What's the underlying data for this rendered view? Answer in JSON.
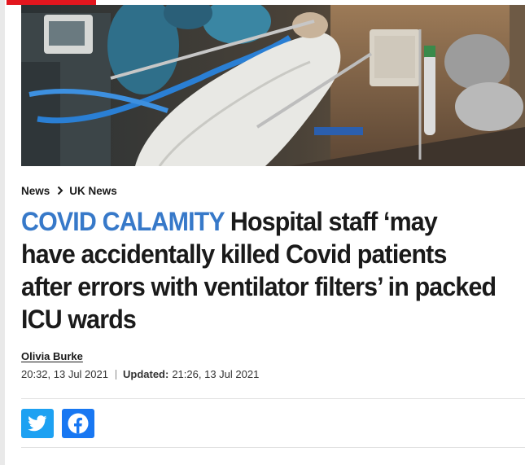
{
  "colors": {
    "kicker": "#3779c9",
    "brand_red": "#e3161e",
    "twitter": "#1da1f2",
    "facebook": "#1877f2"
  },
  "breadcrumb": {
    "items": [
      "News",
      "UK News"
    ],
    "separator_icon": "chevron-right-icon"
  },
  "article": {
    "kicker": "COVID CALAMITY",
    "headline": "Hospital staff ‘may have accidentally killed Covid patients after errors with ventilator filters’ in packed ICU wards",
    "author": "Olivia Burke",
    "published": "20:32, 13 Jul 2021",
    "updated_label": "Updated:",
    "updated": "21:26, 13 Jul 2021"
  },
  "hero_image": {
    "subject": "patient-on-ventilator-in-icu"
  },
  "share": {
    "icons": [
      "twitter-icon",
      "facebook-icon"
    ]
  }
}
